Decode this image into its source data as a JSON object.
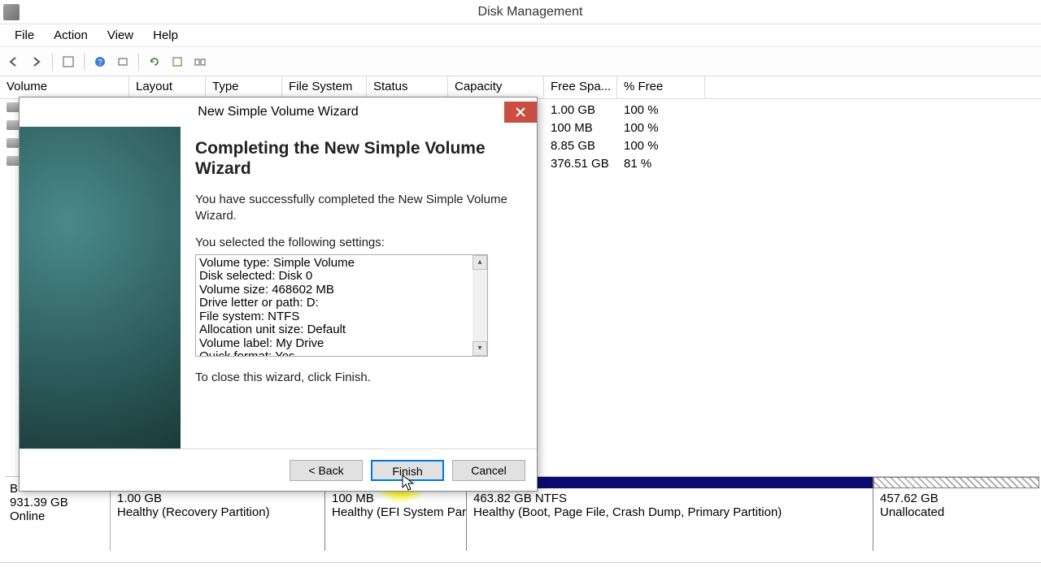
{
  "titlebar": {
    "title": "Disk Management"
  },
  "menu": {
    "file": "File",
    "action": "Action",
    "view": "View",
    "help": "Help"
  },
  "columns": {
    "volume": "Volume",
    "layout": "Layout",
    "type": "Type",
    "filesystem": "File System",
    "status": "Status",
    "capacity": "Capacity",
    "freespace": "Free Spa...",
    "pctfree": "% Free"
  },
  "rows": [
    {
      "freespace": "1.00 GB",
      "pctfree": "100 %"
    },
    {
      "freespace": "100 MB",
      "pctfree": "100 %"
    },
    {
      "freespace": "8.85 GB",
      "pctfree": "100 %"
    },
    {
      "freespace": "376.51 GB",
      "pctfree": "81 %"
    }
  ],
  "wizard": {
    "title": "New Simple Volume Wizard",
    "heading": "Completing the New Simple Volume Wizard",
    "p1": "You have successfully completed the New Simple Volume Wizard.",
    "p2": "You selected the following settings:",
    "settings": [
      "Volume type: Simple Volume",
      "Disk selected: Disk 0",
      "Volume size: 468602 MB",
      "Drive letter or path: D:",
      "File system: NTFS",
      "Allocation unit size: Default",
      "Volume label: My Drive",
      "Quick format: Yes"
    ],
    "p3": "To close this wizard, click Finish.",
    "back": "< Back",
    "finish": "Finish",
    "cancel": "Cancel"
  },
  "disk": {
    "hdr_label": "B",
    "hdr_size": "931.39 GB",
    "hdr_status": "Online",
    "parts": [
      {
        "size": "1.00 GB",
        "status": "Healthy (Recovery Partition)",
        "bar": "navy"
      },
      {
        "size": "100 MB",
        "status": "Healthy (EFI System Par",
        "bar": "navy"
      },
      {
        "size": "463.82 GB NTFS",
        "status": "Healthy (Boot, Page File, Crash Dump, Primary Partition)",
        "bar": "navy"
      },
      {
        "size": "457.62 GB",
        "status": "Unallocated",
        "bar": "hatch"
      }
    ]
  }
}
